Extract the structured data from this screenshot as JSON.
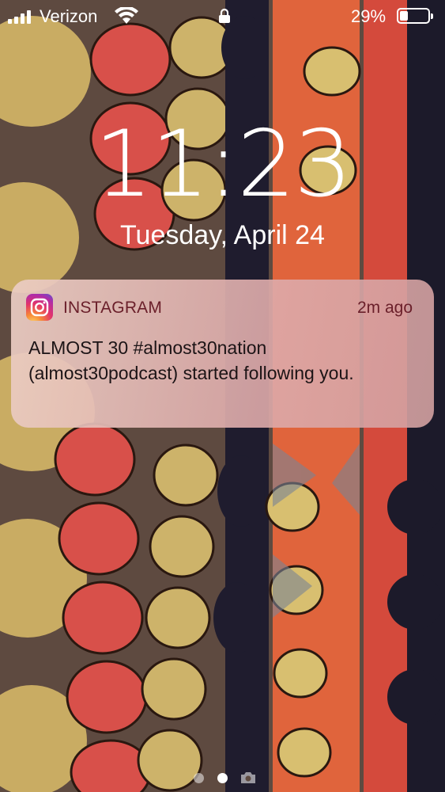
{
  "status_bar": {
    "carrier": "Verizon",
    "battery_percent": "29%",
    "battery_level": 0.29,
    "icons": [
      "signal-icon",
      "wifi-icon",
      "lock-icon",
      "battery-icon"
    ]
  },
  "lock_screen": {
    "time": "11:23",
    "date": "Tuesday, April 24"
  },
  "notification": {
    "app_name": "INSTAGRAM",
    "time_ago": "2m ago",
    "message": "ALMOST 30 #almost30nation (almost30podcast) started following you.",
    "icon": "instagram-icon"
  },
  "page_indicator": {
    "pages": 2,
    "current": 2,
    "icon": "camera-icon"
  },
  "colors": {
    "notification_text": "#1c1416",
    "app_name": "#6a1f2a"
  }
}
